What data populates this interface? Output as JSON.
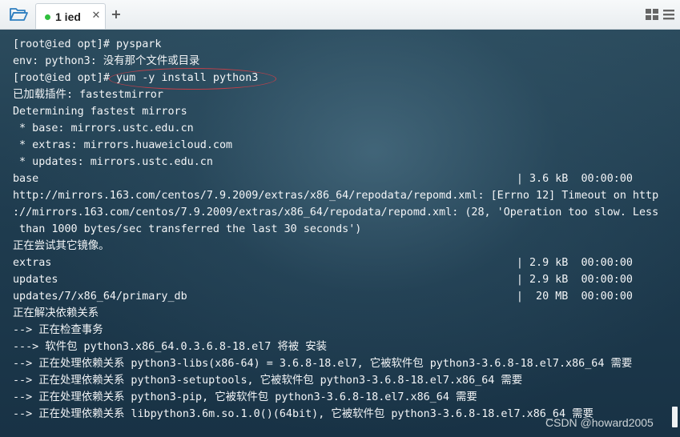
{
  "tabbar": {
    "folder_icon": "folder-open-icon",
    "active_tab": {
      "label": "1 ied",
      "status_color": "#2fbf3d",
      "close_label": "✕"
    },
    "add_tab_label": "+",
    "layout_icon": "grid-layout-icon",
    "menu_icon": "hamburger-menu-icon"
  },
  "terminal": {
    "lines": [
      "[root@ied opt]# pyspark",
      "env: python3: 没有那个文件或目录",
      "[root@ied opt]# yum -y install python3",
      "已加载插件: fastestmirror",
      "Determining fastest mirrors",
      " * base: mirrors.ustc.edu.cn",
      " * extras: mirrors.huaweicloud.com",
      " * updates: mirrors.ustc.edu.cn",
      "base                                                                          | 3.6 kB  00:00:00",
      "http://mirrors.163.com/centos/7.9.2009/extras/x86_64/repodata/repomd.xml: [Errno 12] Timeout on http",
      "://mirrors.163.com/centos/7.9.2009/extras/x86_64/repodata/repomd.xml: (28, 'Operation too slow. Less",
      " than 1000 bytes/sec transferred the last 30 seconds')",
      "正在尝试其它镜像。",
      "extras                                                                        | 2.9 kB  00:00:00",
      "updates                                                                       | 2.9 kB  00:00:00",
      "updates/7/x86_64/primary_db                                                   |  20 MB  00:00:00",
      "正在解决依赖关系",
      "--> 正在检查事务",
      "---> 软件包 python3.x86_64.0.3.6.8-18.el7 将被 安装",
      "--> 正在处理依赖关系 python3-libs(x86-64) = 3.6.8-18.el7, 它被软件包 python3-3.6.8-18.el7.x86_64 需要",
      "--> 正在处理依赖关系 python3-setuptools, 它被软件包 python3-3.6.8-18.el7.x86_64 需要",
      "--> 正在处理依赖关系 python3-pip, 它被软件包 python3-3.6.8-18.el7.x86_64 需要",
      "--> 正在处理依赖关系 libpython3.6m.so.1.0()(64bit), 它被软件包 python3-3.6.8-18.el7.x86_64 需要"
    ],
    "highlight_color": "#c0404a"
  },
  "watermark": "CSDN @howard2005"
}
